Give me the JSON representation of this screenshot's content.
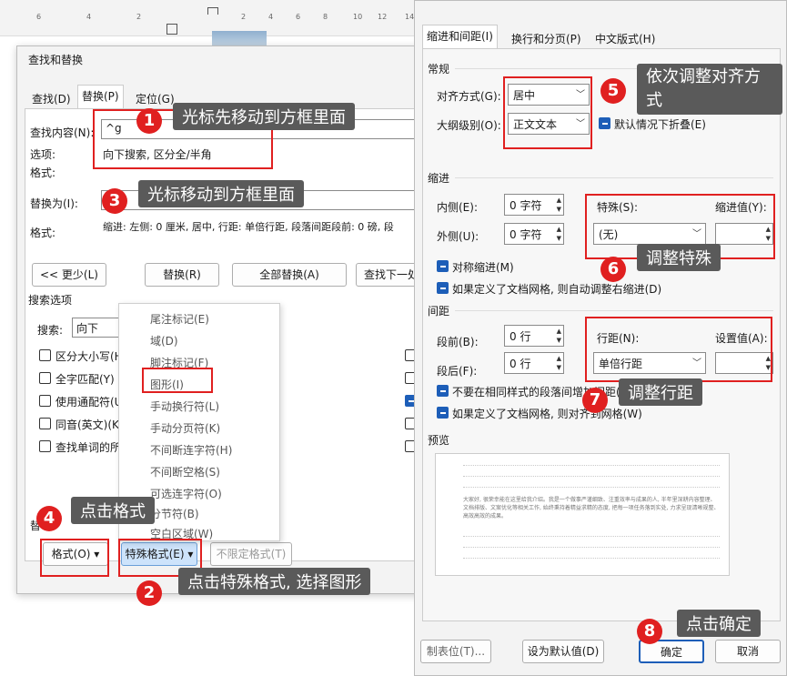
{
  "ruler": {
    "ticks": [
      "6",
      "4",
      "2",
      "2",
      "4",
      "6",
      "8",
      "10",
      "12",
      "14"
    ]
  },
  "find_dialog": {
    "title": "查找和替换",
    "tabs": [
      "查找(D)",
      "替换(P)",
      "定位(G)"
    ],
    "find_label": "查找内容(N):",
    "find_value": "^g",
    "options_label": "选项:",
    "options_value": "向下搜索, 区分全/半角",
    "format_label": "格式:",
    "replace_label": "替换为(I):",
    "replace_format_label": "格式:",
    "replace_format_value": "缩进: 左侧: 0 厘米, 居中, 行距: 单倍行距, 段落间距段前: 0 磅, 段",
    "buttons": {
      "less": "<< 更少(L)",
      "replace": "替换(R)",
      "replace_all": "全部替换(A)",
      "find_next": "查找下一处"
    },
    "search_options_title": "搜索选项",
    "search_label": "搜索:",
    "search_value": "向下",
    "checkboxes": [
      "区分大小写(H",
      "全字匹配(Y)",
      "使用通配符(U",
      "同音(英文)(K",
      "查找单词的所"
    ],
    "replace_section": "替",
    "format_button": "格式(O)",
    "special_button": "特殊格式(E)",
    "no_format_button": "不限定格式(T)"
  },
  "special_menu": {
    "items": [
      "尾注标记(E)",
      "域(D)",
      "脚注标记(F)",
      "图形(I)",
      "手动换行符(L)",
      "手动分页符(K)",
      "不间断连字符(H)",
      "不间断空格(S)",
      "可选连字符(O)",
      "分节符(B)",
      "空白区域(W)"
    ]
  },
  "para_dialog": {
    "tabs": [
      "缩进和间距(I)",
      "换行和分页(P)",
      "中文版式(H)"
    ],
    "general": "常规",
    "alignment_label": "对齐方式(G):",
    "alignment_value": "居中",
    "outline_label": "大纲级别(O):",
    "outline_value": "正文文本",
    "collapse_label": "默认情况下折叠(E)",
    "indent": "缩进",
    "inside_label": "内侧(E):",
    "inside_value": "0 字符",
    "outside_label": "外侧(U):",
    "outside_value": "0 字符",
    "special_label": "特殊(S):",
    "special_value": "(无)",
    "indent_value_label": "缩进值(Y):",
    "mirror_label": "对称缩进(M)",
    "auto_right_label": "如果定义了文档网格, 则自动调整右缩进(D)",
    "spacing": "间距",
    "before_label": "段前(B):",
    "before_value": "0 行",
    "after_label": "段后(F):",
    "after_value": "0 行",
    "line_spacing_label": "行距(N):",
    "line_spacing_value": "单倍行距",
    "set_value_label": "设置值(A):",
    "no_space_label": "不要在相同样式的段落间增加间距(C)",
    "grid_label": "如果定义了文档网格, 则对齐到网格(W)",
    "preview": "预览",
    "preview_text": "大家好, 很荣幸能在这里给我介绍。我是一个做事严谨细致、注重效率与成果的人, 半年里深耕内容整理、文档排版、文案优化等相关工作, 始终秉持着精益求精的态度, 把每一项任务落到实处, 力求呈现清晰规整、高效高效的成果。",
    "tab_stops_button": "制表位(T)...",
    "default_button": "设为默认值(D)",
    "ok_button": "确定",
    "cancel_button": "取消"
  },
  "annotations": {
    "step1": "光标先移动到方框里面",
    "step2": "点击特殊格式, 选择图形",
    "step3": "光标移动到方框里面",
    "step4": "点击格式",
    "step5": "依次调整对齐方式",
    "step6": "调整特殊",
    "step7": "调整行距",
    "step8": "点击确定",
    "badges": [
      "1",
      "2",
      "3",
      "4",
      "5",
      "6",
      "7",
      "8"
    ]
  },
  "colors": {
    "accent": "#1d5eb8",
    "annotation_red": "#e02020",
    "note_bg": "#5a5a5a"
  }
}
